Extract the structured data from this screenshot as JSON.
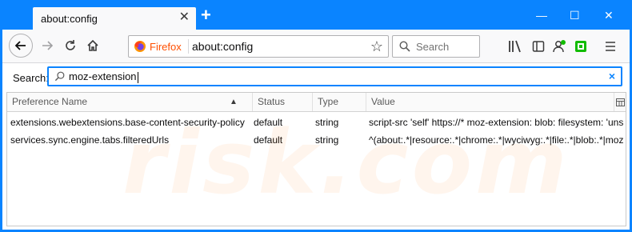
{
  "tab": {
    "title": "about:config",
    "close": "✕"
  },
  "newtab": "+",
  "window_controls": {
    "minimize": "—",
    "maximize": "☐",
    "close": "✕"
  },
  "urlbar": {
    "identity": "Firefox",
    "url": "about:config"
  },
  "searchbar": {
    "placeholder": "Search"
  },
  "filter": {
    "label": "Search:",
    "value": "moz-extension",
    "clear": "×"
  },
  "table": {
    "columns": [
      "Preference Name",
      "Status",
      "Type",
      "Value"
    ],
    "sort_indicator": "▲",
    "rows": [
      {
        "name": "extensions.webextensions.base-content-security-policy",
        "status": "default",
        "type": "string",
        "value": "script-src 'self' https://* moz-extension: blob: filesystem: 'unsafe..."
      },
      {
        "name": "services.sync.engine.tabs.filteredUrls",
        "status": "default",
        "type": "string",
        "value": "^(about:.*|resource:.*|chrome:.*|wyciwyg:.*|file:.*|blob:.*|moz-ext..."
      }
    ]
  },
  "watermark": "risk.com",
  "colors": {
    "accent": "#0a84ff",
    "firefox_orange": "#ff4f00",
    "sync_green": "#12bc00"
  }
}
